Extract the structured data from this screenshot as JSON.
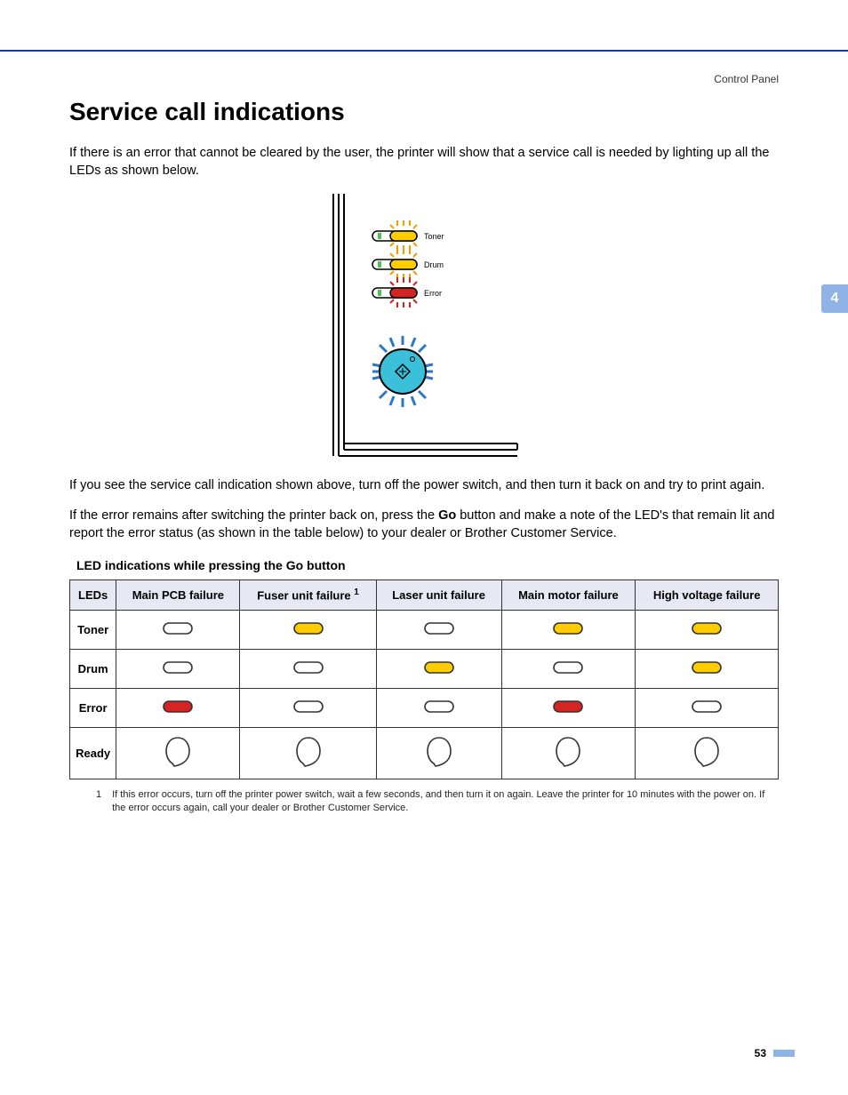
{
  "header": {
    "section_label": "Control Panel"
  },
  "side_tab": "4",
  "title": "Service call indications",
  "paragraphs": {
    "p1": "If there is an error that cannot be cleared by the user, the printer will show that a service call is needed by lighting up all the LEDs as shown below.",
    "p2a": "If you see the service call indication shown above, turn off the power switch, and then turn it back on and try to print again.",
    "p2b_pre": "If the error remains after switching the printer back on, press the ",
    "p2b_bold": "Go",
    "p2b_post": " button and make a note of the LED's that remain lit and report the error status (as shown in the table below) to your dealer or Brother Customer Service."
  },
  "diagram": {
    "led_labels": {
      "toner": "Toner",
      "drum": "Drum",
      "error": "Error"
    }
  },
  "table": {
    "caption": "LED indications while pressing the Go button",
    "columns": [
      "LEDs",
      "Main PCB failure",
      "Fuser unit failure",
      "Laser unit failure",
      "Main motor failure",
      "High voltage failure"
    ],
    "fuser_sup": "1",
    "rows": [
      {
        "label": "Toner",
        "cells": [
          "off",
          "yellow",
          "off",
          "yellow",
          "yellow"
        ]
      },
      {
        "label": "Drum",
        "cells": [
          "off",
          "off",
          "yellow",
          "off",
          "yellow"
        ]
      },
      {
        "label": "Error",
        "cells": [
          "red",
          "off",
          "off",
          "red",
          "off"
        ]
      },
      {
        "label": "Ready",
        "cells": [
          "ready-off",
          "ready-off",
          "ready-off",
          "ready-off",
          "ready-off"
        ]
      }
    ]
  },
  "footnote": {
    "num": "1",
    "text": "If this error occurs, turn off the printer power switch, wait a few seconds, and then turn it on again. Leave the printer for 10 minutes with the power on. If the error occurs again, call your dealer or Brother Customer Service."
  },
  "page_number": "53"
}
